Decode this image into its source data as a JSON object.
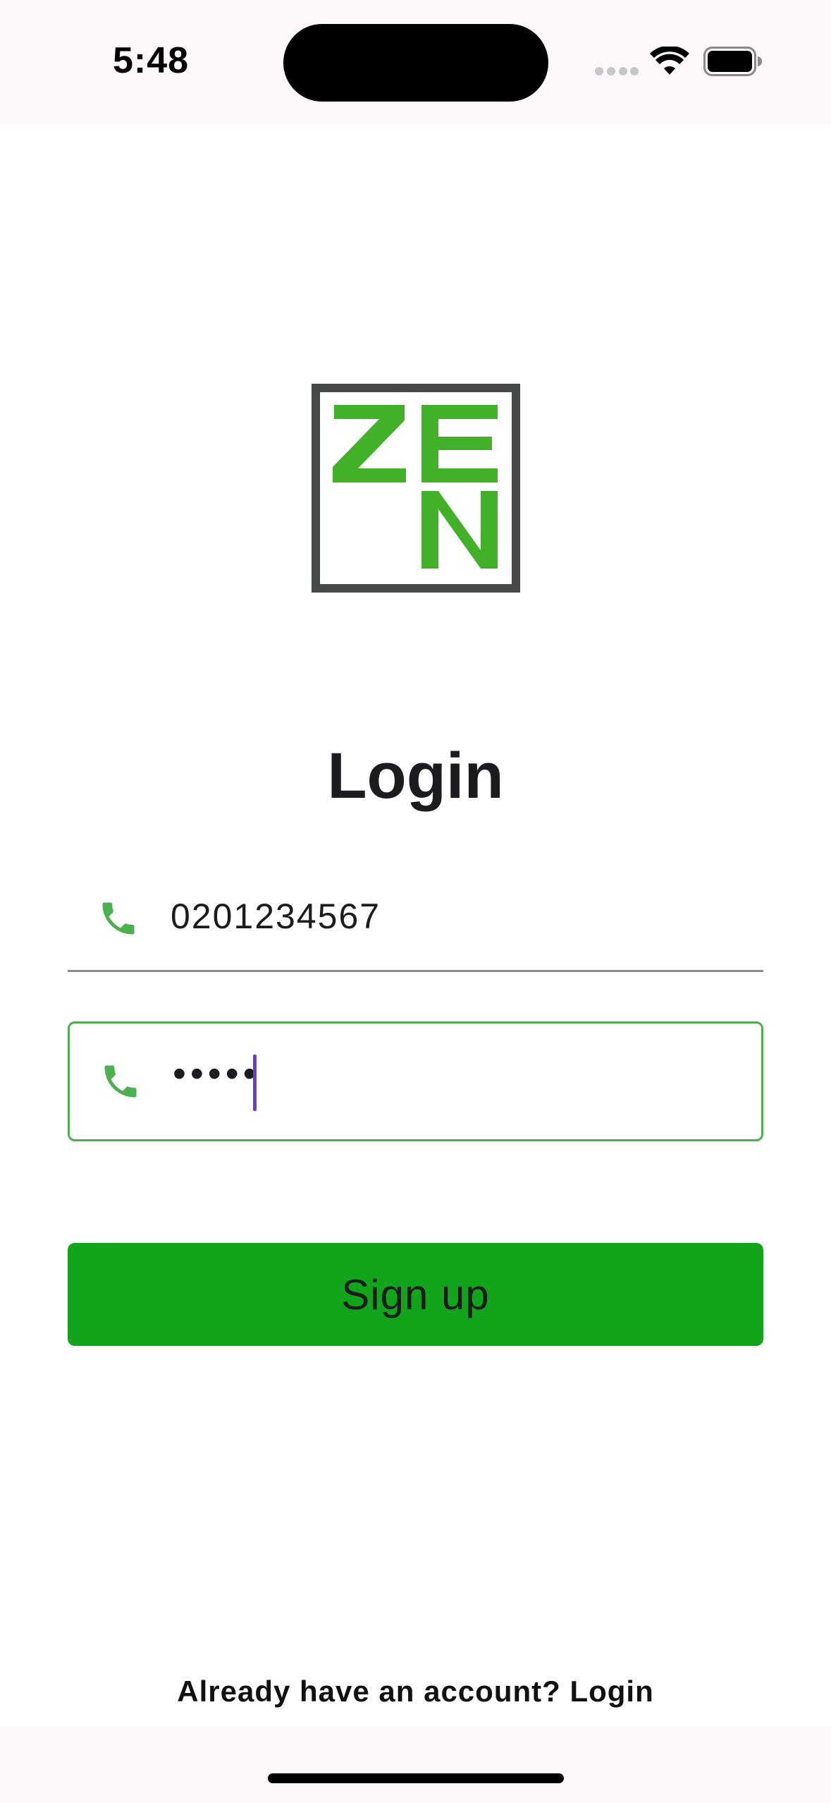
{
  "status_bar": {
    "time": "5:48",
    "icons": [
      "signal-icon",
      "wifi-icon",
      "battery-icon"
    ]
  },
  "logo": {
    "text_top": "ZE",
    "text_bottom": "N",
    "colors": {
      "border": "#454a47",
      "letters": "#43b02a"
    }
  },
  "title": "Login",
  "phone_field": {
    "icon": "phone-icon",
    "value": "0201234567"
  },
  "password_field": {
    "icon": "phone-icon",
    "value": "•••••",
    "focused": true
  },
  "signup_button": {
    "label": "Sign up"
  },
  "footer": {
    "text": "Already have an account? Login"
  },
  "colors": {
    "accent_green": "#12a41a",
    "icon_green": "#4caf50",
    "caret": "#6a3fc7",
    "status_bar_bg": "#fdf7fb"
  }
}
